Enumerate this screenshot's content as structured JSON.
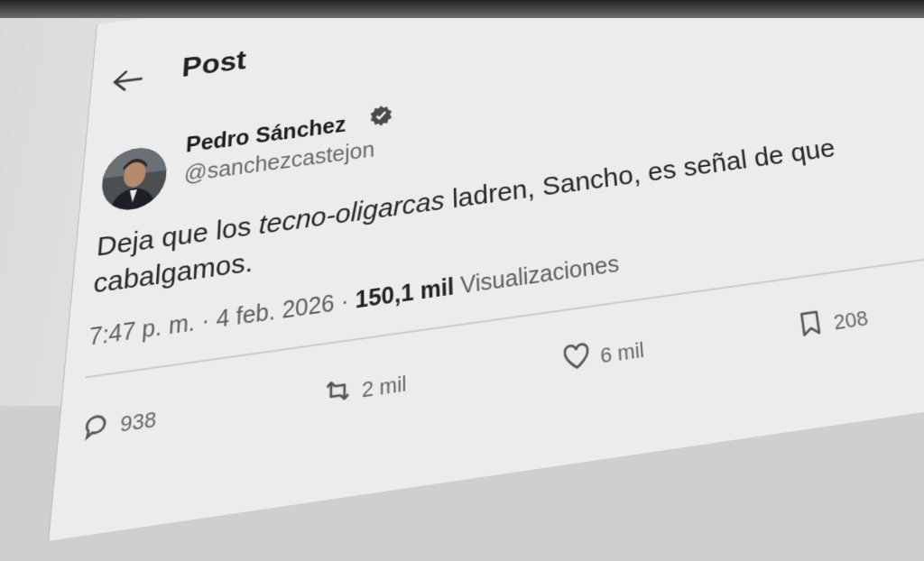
{
  "header": {
    "title": "Post"
  },
  "author": {
    "name": "Pedro Sánchez",
    "handle": "@sanchezcastejon"
  },
  "post": {
    "text_before": "Deja que los ",
    "text_italic": "tecno-oligarcas",
    "text_after_line1": " ladren, Sancho, es señal de que",
    "text_line2": "cabalgamos."
  },
  "meta": {
    "time": "7:47 p. m.",
    "separator1": " · ",
    "date": "4 feb. 2026",
    "separator2": " · ",
    "views_count": "150,1 mil",
    "views_label": " Visualizaciones"
  },
  "actions": {
    "replies": "938",
    "reposts": "2 mil",
    "likes": "6 mil",
    "bookmarks": "208"
  },
  "icons": [
    "arrow-left-icon",
    "verified-badge-icon",
    "reply-icon",
    "repost-icon",
    "heart-icon",
    "bookmark-icon"
  ],
  "colors": {
    "verified": "#4a4a4a",
    "text": "#262626",
    "secondary": "#666666"
  }
}
